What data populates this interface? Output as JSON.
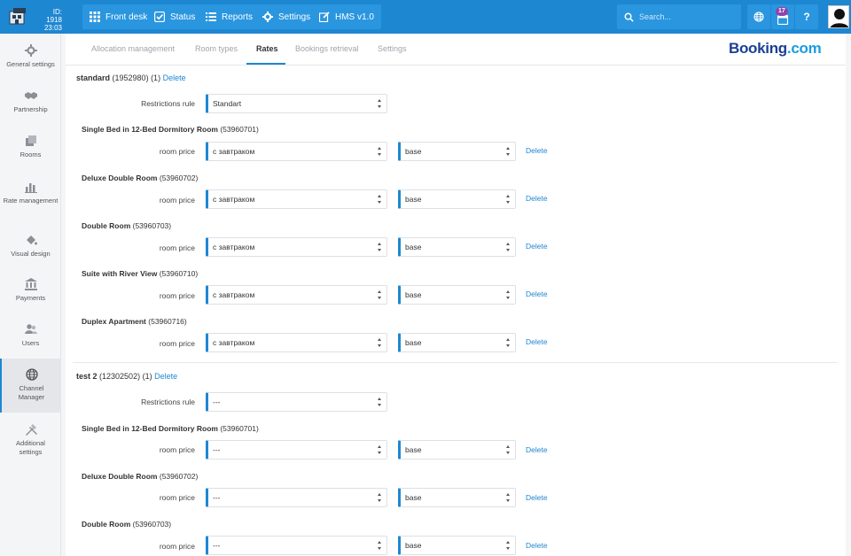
{
  "header": {
    "hotel_id": "ID: 1918",
    "time": "23:03",
    "nav": [
      {
        "label": "Front desk"
      },
      {
        "label": "Status"
      },
      {
        "label": "Reports"
      },
      {
        "label": "Settings"
      },
      {
        "label": "HMS v1.0"
      }
    ],
    "search_placeholder": "Search...",
    "notifications_count": "17",
    "help_label": "?"
  },
  "sidebar": {
    "items": [
      {
        "label": "General settings"
      },
      {
        "label": "Partnership"
      },
      {
        "label": "Rooms"
      },
      {
        "label": "Rate management"
      },
      {
        "label": "Visual design"
      },
      {
        "label": "Payments"
      },
      {
        "label": "Users"
      },
      {
        "label": "Channel Manager"
      },
      {
        "label": "Additional settings"
      }
    ]
  },
  "tabs": [
    {
      "label": "Allocation management"
    },
    {
      "label": "Room types"
    },
    {
      "label": "Rates"
    },
    {
      "label": "Bookings retrieval"
    },
    {
      "label": "Settings"
    }
  ],
  "brand": {
    "name": "Booking",
    "suffix": ".com"
  },
  "labels": {
    "restrictions_rule": "Restrictions rule",
    "room_price": "room price",
    "delete": "Delete"
  },
  "rates": [
    {
      "name": "standard",
      "meta": "(1952980) (1)",
      "restriction": "Standart",
      "rooms": [
        {
          "name": "Single Bed in 12-Bed Dormitory Room",
          "id": "(53960701)",
          "price": "с завтраком",
          "base": "base"
        },
        {
          "name": "Deluxe Double Room",
          "id": "(53960702)",
          "price": "с завтраком",
          "base": "base"
        },
        {
          "name": "Double Room",
          "id": "(53960703)",
          "price": "с завтраком",
          "base": "base"
        },
        {
          "name": "Suite with River View",
          "id": "(53960710)",
          "price": "с завтраком",
          "base": "base"
        },
        {
          "name": "Duplex Apartment",
          "id": "(53960716)",
          "price": "с завтраком",
          "base": "base"
        }
      ]
    },
    {
      "name": "test 2",
      "meta": "(12302502) (1)",
      "restriction": "---",
      "rooms": [
        {
          "name": "Single Bed in 12-Bed Dormitory Room",
          "id": "(53960701)",
          "price": "---",
          "base": "base"
        },
        {
          "name": "Deluxe Double Room",
          "id": "(53960702)",
          "price": "---",
          "base": "base"
        },
        {
          "name": "Double Room",
          "id": "(53960703)",
          "price": "---",
          "base": "base"
        }
      ]
    }
  ],
  "colors": {
    "accent": "#1e87d2",
    "topbar": "#1e87d2",
    "badge": "#8e44ad",
    "brand_dark": "#1c3f95",
    "brand_light": "#1a9be0"
  }
}
